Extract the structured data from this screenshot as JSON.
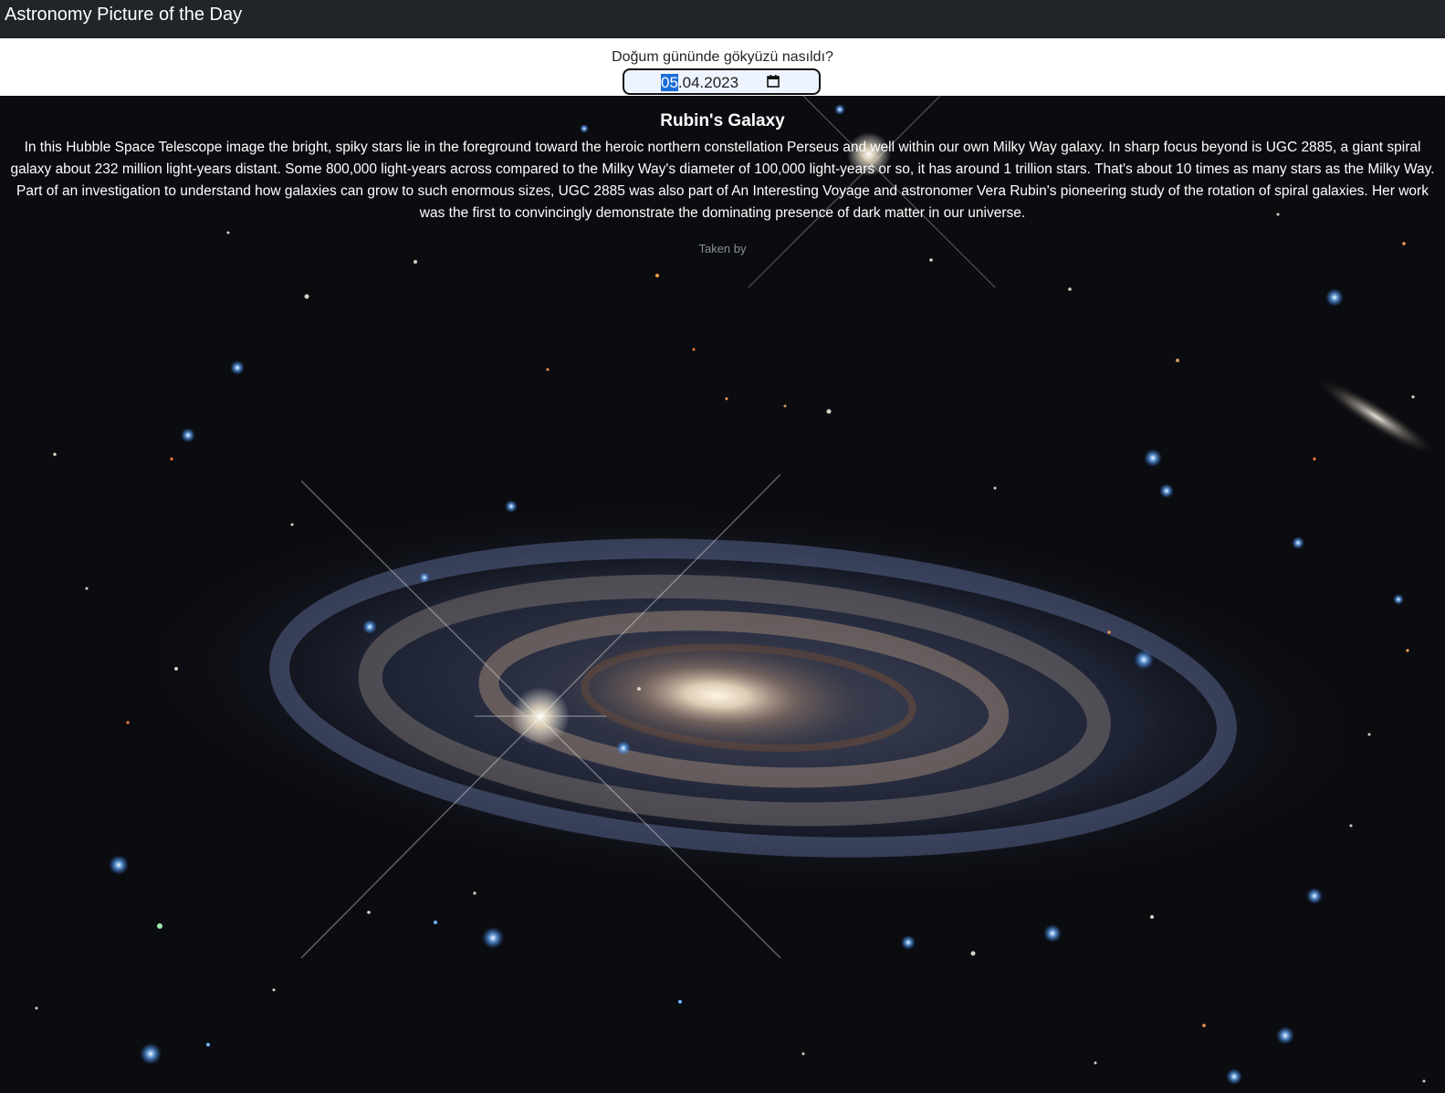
{
  "navbar": {
    "brand": "Astronomy Picture of the Day"
  },
  "date_picker": {
    "prompt": "Doğum gününde gökyüzü nasıldı?",
    "day": "05",
    "rest": ".04.2023",
    "icon": "calendar-icon"
  },
  "apod": {
    "title": "Rubin's Galaxy",
    "explanation": "In this Hubble Space Telescope image the bright, spiky stars lie in the foreground toward the heroic northern constellation Perseus and well within our own Milky Way galaxy. In sharp focus beyond is UGC 2885, a giant spiral galaxy about 232 million light-years distant. Some 800,000 light-years across compared to the Milky Way's diameter of 100,000 light-years or so, it has around 1 trillion stars. That's about 10 times as many stars as the Milky Way. Part of an investigation to understand how galaxies can grow to such enormous sizes, UGC 2885 was also part of An Interesting Voyage and astronomer Vera Rubin's pioneering study of the rotation of spiral galaxies. Her work was the first to convincingly demonstrate the dominating presence of dark matter in our universe.",
    "credit": "Taken by"
  },
  "colors": {
    "navbar_bg": "#212529",
    "space_bg": "#0b0c10",
    "selection": "#1a6ed8"
  }
}
